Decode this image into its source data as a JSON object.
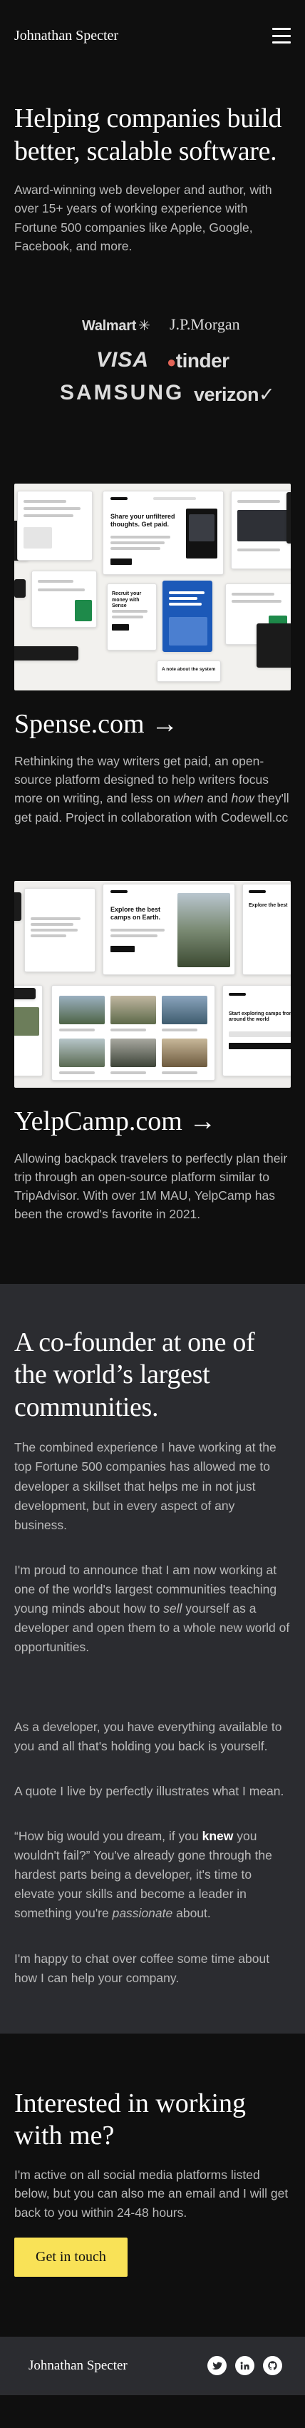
{
  "header": {
    "brand": "Johnathan Specter"
  },
  "hero": {
    "title": "Helping companies build better, scalable software.",
    "text": "Award-winning web developer and author, with over 15+ years of working experience with Fortune 500 companies like Apple, Google, Facebook, and more."
  },
  "logos": {
    "walmart": "Walmart",
    "jpmorgan": "J.P.Morgan",
    "visa": "VISA",
    "tinder": "tinder",
    "samsung": "SAMSUNG",
    "verizon": "verizon✓"
  },
  "projects": [
    {
      "title": "Spense.com →",
      "text_parts": [
        "Rethinking the way writers get paid, an open-source platform designed to help writers focus more on writing, and less on ",
        "when",
        " and ",
        "how",
        " they'll get paid. Project in collaboration with Codewell.cc"
      ],
      "mock": {
        "headline": "Share your unfiltered thoughts. Get paid.",
        "card_headline": "Recruit your money with Sense",
        "footer": "A note about the system"
      }
    },
    {
      "title": "YelpCamp.com →",
      "text": "Allowing backpack travelers to perfectly plan their trip through an open-source platform similar to TripAdvisor. With over 1M MAU, YelpCamp has been the crowd's favorite in 2021.",
      "mock": {
        "headline": "Explore the best camps on Earth.",
        "footer": "Start exploring camps from all around the world"
      }
    }
  ],
  "cofounder": {
    "title": "A co-founder at one of the world’s largest communities.",
    "p1": "The combined experience I have working at the top Fortune 500 companies has allowed me to developer a skillset that helps me in not just development, but in every aspect of any business.",
    "p2_parts": [
      "I'm proud to announce that I am now working at one of the world's largest communities teaching young minds about how to ",
      "sell",
      " yourself as a developer and open them to a whole new world of opportunities."
    ],
    "p3": "As a developer, you have everything available to you and all that's holding you back is yourself.",
    "p4": "A quote I live by perfectly illustrates what I mean.",
    "p5_parts": [
      "“How big would you dream, if you ",
      "knew",
      " you wouldn't fail?” You've already gone through the hardest parts being a developer, it's time to elevate your skills and become a leader in something you're ",
      "passionate",
      " about."
    ],
    "p6": "I'm happy to chat over coffee some time about how I can help your company."
  },
  "contact": {
    "title": "Interested in working with me?",
    "text": "I'm active on all social media platforms listed below, but you can also me an email and I will get back to you within 24-48 hours.",
    "cta": "Get in touch"
  },
  "footer": {
    "brand": "Johnathan Specter",
    "socials": [
      "twitter-icon",
      "linkedin-icon",
      "github-icon"
    ]
  },
  "colors": {
    "background": "#0f0f0f",
    "panel": "#2b2c30",
    "accent": "#f9e257",
    "muted_text": "#b9b9b9"
  }
}
